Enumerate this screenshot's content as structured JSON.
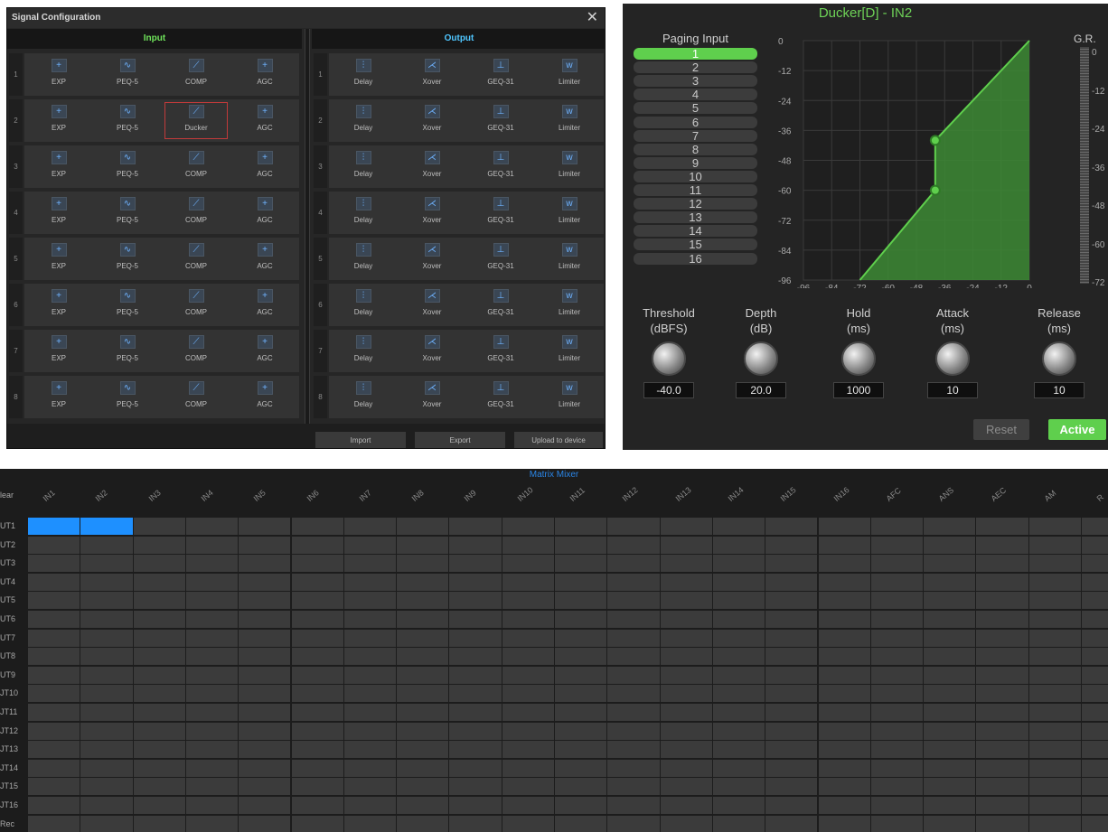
{
  "signal_config": {
    "title": "Signal Configuration",
    "close_icon": "close-icon",
    "input_header": "Input",
    "output_header": "Output",
    "rows": [
      "1",
      "2",
      "3",
      "4",
      "5",
      "6",
      "7",
      "8"
    ],
    "input_modules": [
      "EXP",
      "PEQ-5",
      "COMP",
      "AGC"
    ],
    "input_icons": [
      "plus-icon",
      "eq-curve-icon",
      "compressor-icon",
      "plus-icon"
    ],
    "ducker_row_index": 1,
    "ducker_label": "Ducker",
    "output_modules": [
      "Delay",
      "Xover",
      "GEQ-31",
      "Limiter"
    ],
    "output_icons": [
      "delay-icon",
      "crossover-icon",
      "graphic-eq-icon",
      "limiter-icon"
    ],
    "buttons": {
      "import": "Import",
      "export": "Export",
      "upload": "Upload to device"
    }
  },
  "ducker": {
    "title": "Ducker[D] - IN2",
    "paging_label": "Paging Input",
    "paging_items": [
      "1",
      "2",
      "3",
      "4",
      "5",
      "6",
      "7",
      "8",
      "9",
      "10",
      "11",
      "12",
      "13",
      "14",
      "15",
      "16"
    ],
    "paging_selected": "1",
    "gr_label": "G.R.",
    "gr_ticks": [
      "0",
      "-12",
      "-24",
      "-36",
      "-48",
      "-60",
      "-72"
    ],
    "knobs": [
      {
        "label": "Threshold",
        "unit": "(dBFS)",
        "value": "-40.0"
      },
      {
        "label": "Depth",
        "unit": "(dB)",
        "value": "20.0"
      },
      {
        "label": "Hold",
        "unit": "(ms)",
        "value": "1000"
      },
      {
        "label": "Attack",
        "unit": "(ms)",
        "value": "10"
      },
      {
        "label": "Release",
        "unit": "(ms)",
        "value": "10"
      }
    ],
    "reset_label": "Reset",
    "active_label": "Active",
    "colors": {
      "accent": "#5fcf4d"
    }
  },
  "chart_data": {
    "type": "line",
    "x": [
      -72,
      -40,
      -40,
      0
    ],
    "y": [
      -96,
      -60,
      -40,
      0
    ],
    "x_ticks": [
      "-96",
      "-84",
      "-72",
      "-60",
      "-48",
      "-36",
      "-24",
      "-12",
      "0"
    ],
    "y_ticks": [
      "0",
      "-12",
      "-24",
      "-36",
      "-48",
      "-60",
      "-72",
      "-84",
      "-96"
    ],
    "xlim": [
      -96,
      0
    ],
    "ylim": [
      -96,
      0
    ],
    "grid": true,
    "fill": "area-under-line",
    "color": "#5fcf4d"
  },
  "matrix": {
    "title": "Matrix Mixer",
    "corner": "lear",
    "columns": [
      "IN1",
      "IN2",
      "IN3",
      "IN4",
      "IN5",
      "IN6",
      "IN7",
      "IN8",
      "IN9",
      "IN10",
      "IN11",
      "IN12",
      "IN13",
      "IN14",
      "IN15",
      "IN16",
      "AFC",
      "ANS",
      "AEC",
      "AM",
      "R"
    ],
    "rows": [
      "UT1",
      "UT2",
      "UT3",
      "UT4",
      "UT5",
      "UT6",
      "UT7",
      "UT8",
      "UT9",
      "JT10",
      "JT11",
      "JT12",
      "JT13",
      "JT14",
      "JT15",
      "JT16",
      "Rec"
    ],
    "active_cells": [
      [
        0,
        0
      ],
      [
        0,
        1
      ]
    ],
    "colors": {
      "active": "#1e90ff",
      "title": "#2a86e8"
    }
  }
}
